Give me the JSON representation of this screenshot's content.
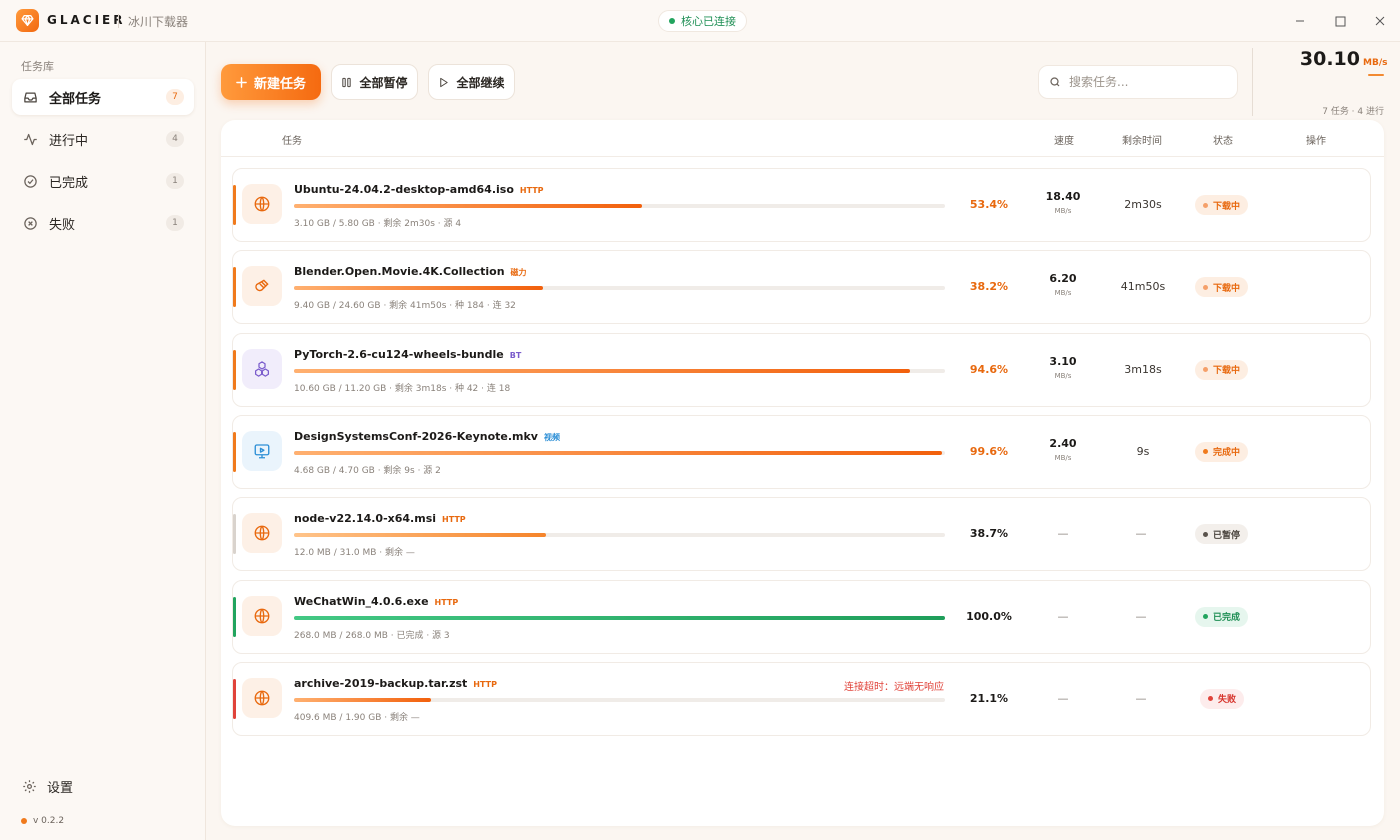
{
  "app": {
    "brand": "GLACIER",
    "subtitle": "冰川下载器",
    "core_status": "核心已连接"
  },
  "sidebar": {
    "heading": "任务库",
    "items": [
      {
        "label": "全部任务",
        "count": "7",
        "icon": "inbox-icon"
      },
      {
        "label": "进行中",
        "count": "4",
        "icon": "activity-icon"
      },
      {
        "label": "已完成",
        "count": "1",
        "icon": "check-circle-icon"
      },
      {
        "label": "失败",
        "count": "1",
        "icon": "x-circle-icon"
      }
    ],
    "settings_label": "设置",
    "version": "v 0.2.2"
  },
  "toolbar": {
    "new_label": "新建任务",
    "pause_all_label": "全部暂停",
    "resume_all_label": "全部继续",
    "search_placeholder": "搜索任务..."
  },
  "stats": {
    "total_speed": "30.10",
    "total_unit": "MB/s",
    "summary": "7 任务 · 4 进行"
  },
  "table": {
    "headers": {
      "task": "任务",
      "speed": "速度",
      "eta": "剩余时间",
      "status": "状态",
      "actions": "操作"
    }
  },
  "tasks": [
    {
      "name": "Ubuntu-24.04.2-desktop-amd64.iso",
      "tag": "HTTP",
      "tag_color": "#e8690f",
      "icon": "globe-icon",
      "icon_color": "#e8690f",
      "icon_bg": "#fdf0e6",
      "accent": "#f07a1c",
      "progress": 53.4,
      "percent": "53.4%",
      "percent_color": "#e8690f",
      "fill": "linear-gradient(90deg,#ffb070,#f2600c)",
      "meta": "3.10 GB / 5.80 GB · 剩余 2m30s · 源 4",
      "speed": "18.40",
      "speed_unit": "MB/s",
      "eta": "2m30s",
      "status": "下载中",
      "status_bg": "#fdeee2",
      "status_color": "#e8690f",
      "status_dot": "#f5a06a",
      "error": ""
    },
    {
      "name": "Blender.Open.Movie.4K.Collection",
      "tag": "磁力",
      "tag_color": "#e8690f",
      "icon": "magnet-icon",
      "icon_color": "#e8690f",
      "icon_bg": "#fdf0e6",
      "accent": "#f07a1c",
      "progress": 38.2,
      "percent": "38.2%",
      "percent_color": "#e8690f",
      "fill": "linear-gradient(90deg,#ffb070,#f2600c)",
      "meta": "9.40 GB / 24.60 GB · 剩余 41m50s · 种 184 · 连 32",
      "speed": "6.20",
      "speed_unit": "MB/s",
      "eta": "41m50s",
      "status": "下载中",
      "status_bg": "#fdeee2",
      "status_color": "#e8690f",
      "status_dot": "#f5a06a",
      "error": ""
    },
    {
      "name": "PyTorch-2.6-cu124-wheels-bundle",
      "tag": "BT",
      "tag_color": "#7a5ccc",
      "icon": "cubes-icon",
      "icon_color": "#7a5ccc",
      "icon_bg": "#f1edfb",
      "accent": "#f07a1c",
      "progress": 94.6,
      "percent": "94.6%",
      "percent_color": "#e8690f",
      "fill": "linear-gradient(90deg,#ffb070,#f2600c)",
      "meta": "10.60 GB / 11.20 GB · 剩余 3m18s · 种 42 · 连 18",
      "speed": "3.10",
      "speed_unit": "MB/s",
      "eta": "3m18s",
      "status": "下载中",
      "status_bg": "#fdeee2",
      "status_color": "#e8690f",
      "status_dot": "#f5a06a",
      "error": ""
    },
    {
      "name": "DesignSystemsConf-2026-Keynote.mkv",
      "tag": "视频",
      "tag_color": "#2d8fd6",
      "icon": "monitor-play-icon",
      "icon_color": "#2d8fd6",
      "icon_bg": "#eaf4fc",
      "accent": "#f07a1c",
      "progress": 99.6,
      "percent": "99.6%",
      "percent_color": "#e8690f",
      "fill": "linear-gradient(90deg,#ffb070,#f2600c)",
      "meta": "4.68 GB / 4.70 GB · 剩余 9s · 源 2",
      "speed": "2.40",
      "speed_unit": "MB/s",
      "eta": "9s",
      "status": "完成中",
      "status_bg": "#fdeee2",
      "status_color": "#e8690f",
      "status_dot": "#f07a1c",
      "error": ""
    },
    {
      "name": "node-v22.14.0-x64.msi",
      "tag": "HTTP",
      "tag_color": "#e8690f",
      "icon": "globe-icon",
      "icon_color": "#e8690f",
      "icon_bg": "#fdf0e6",
      "accent": "#d9d3cd",
      "progress": 38.7,
      "percent": "38.7%",
      "percent_color": "#1c1a18",
      "fill": "linear-gradient(90deg,#ffc48a,#f5842a)",
      "meta": "12.0 MB / 31.0 MB · 剩余 —",
      "speed": "—",
      "speed_unit": "",
      "eta": "—",
      "status": "已暂停",
      "status_bg": "#f3efeb",
      "status_color": "#4a443e",
      "status_dot": "#5a534c",
      "error": ""
    },
    {
      "name": "WeChatWin_4.0.6.exe",
      "tag": "HTTP",
      "tag_color": "#e8690f",
      "icon": "globe-icon",
      "icon_color": "#e8690f",
      "icon_bg": "#fdf0e6",
      "accent": "#22a45e",
      "progress": 100,
      "percent": "100.0%",
      "percent_color": "#1c1a18",
      "fill": "linear-gradient(90deg,#43c884,#1f9e5a)",
      "meta": "268.0 MB / 268.0 MB · 已完成 · 源 3",
      "speed": "—",
      "speed_unit": "",
      "eta": "—",
      "status": "已完成",
      "status_bg": "#e6f6ee",
      "status_color": "#1f8f55",
      "status_dot": "#22a45e",
      "error": ""
    },
    {
      "name": "archive-2019-backup.tar.zst",
      "tag": "HTTP",
      "tag_color": "#e8690f",
      "icon": "globe-icon",
      "icon_color": "#e8690f",
      "icon_bg": "#fdf0e6",
      "accent": "#e0433a",
      "progress": 21.1,
      "percent": "21.1%",
      "percent_color": "#1c1a18",
      "fill": "linear-gradient(90deg,#ffb070,#f2600c)",
      "meta": "409.6 MB / 1.90 GB · 剩余 —",
      "speed": "—",
      "speed_unit": "",
      "eta": "—",
      "status": "失败",
      "status_bg": "#fdecec",
      "status_color": "#d6332b",
      "status_dot": "#e0433a",
      "error": "连接超时：远端无响应"
    }
  ]
}
